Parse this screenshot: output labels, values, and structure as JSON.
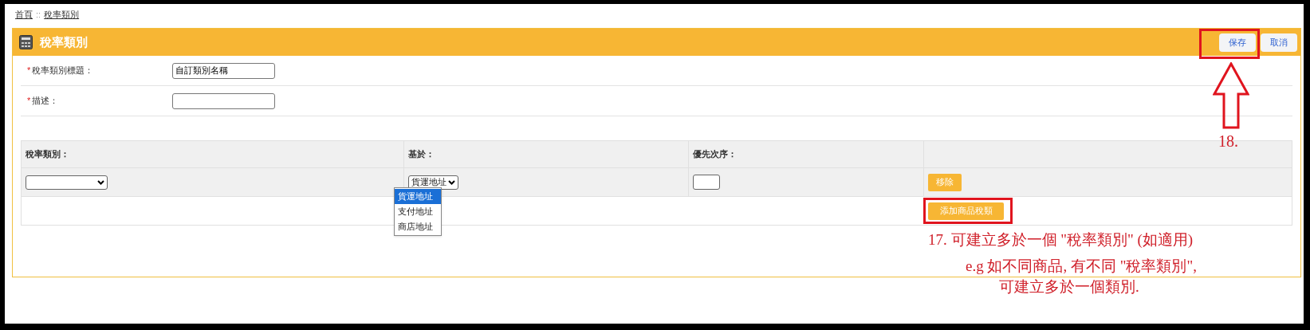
{
  "breadcrumb": {
    "items": [
      {
        "label": "首頁"
      },
      {
        "label": "稅率類別"
      }
    ],
    "separator": "::"
  },
  "panel": {
    "title": "稅率類別",
    "buttons": [
      {
        "label": "保存"
      },
      {
        "label": "取消"
      }
    ]
  },
  "form": [
    {
      "marker": "*",
      "label": "稅率類別標題：",
      "value": "自訂類別名稱"
    },
    {
      "marker": "*",
      "label": "描述："
    }
  ],
  "table": {
    "columns": [
      "稅率類別：",
      "基於：",
      "優先次序：",
      ""
    ],
    "rows": [
      {
        "tax_class": "",
        "based_on": "貨運地址",
        "priority": "",
        "button": "移除"
      }
    ],
    "add_button": "添加商品稅類"
  },
  "dropdown": {
    "options": [
      {
        "label": "貨運地址",
        "selected": true
      },
      {
        "label": "支付地址",
        "selected": false
      },
      {
        "label": "商店地址",
        "selected": false
      }
    ]
  },
  "annotations": {
    "save_note": "18.",
    "add_note_lines": [
      "17. 可建立多於一個 \"稅率類別\" (如適用)",
      "e.g 如不同商品, 有不同 \"稅率類別\",",
      "可建立多於一個類別."
    ]
  }
}
